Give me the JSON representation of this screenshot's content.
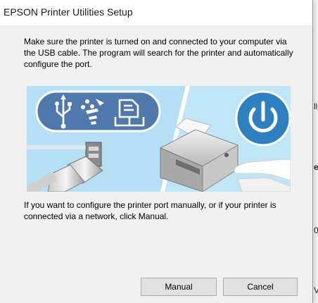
{
  "window": {
    "title": "EPSON Printer Utilities Setup"
  },
  "content": {
    "instruction": "Make sure the printer is turned on and connected to your computer via the USB cable. The program will search for the printer and automatically configure the port.",
    "manual_hint": "If you want to configure the printer port manually, or if your printer is connected via a network, click Manual."
  },
  "buttons": {
    "manual": "Manual",
    "cancel": "Cancel"
  },
  "background_window": {
    "fragments": [
      "ll",
      "e",
      "0",
      "V"
    ]
  },
  "icons": [
    "usb-icon",
    "firewire-icon",
    "network-document-icon",
    "power-icon",
    "usb-cable",
    "printer"
  ],
  "colors": {
    "dialog_bg": "#f0f0f0",
    "illustration_bg": "#b5dff4",
    "icon_panel": "#4f78ad",
    "power_button": "#2d7fbf"
  }
}
